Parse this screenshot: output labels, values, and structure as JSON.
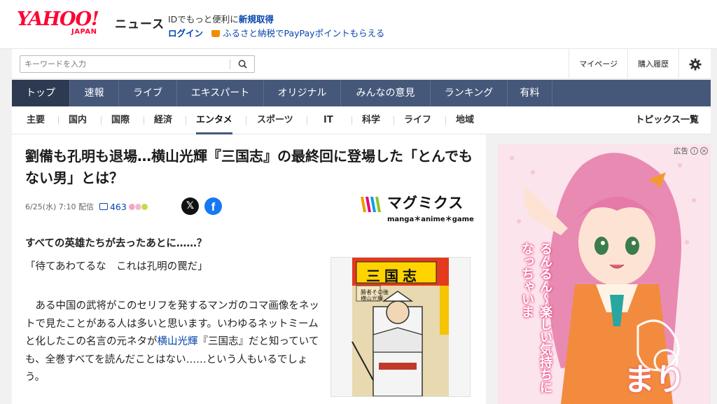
{
  "header": {
    "logo_text": "YAHOO!",
    "logo_sub": "JAPAN",
    "service": "ニュース",
    "id_prompt": "IDでもっと便利に",
    "register": "新規取得",
    "login": "ログイン",
    "promo": "ふるさと納税でPayPayポイントもらえる"
  },
  "search": {
    "placeholder": "キーワードを入力"
  },
  "header_links": [
    "マイページ",
    "購入履歴"
  ],
  "main_nav": [
    {
      "label": "トップ",
      "active": true
    },
    {
      "label": "速報"
    },
    {
      "label": "ライブ"
    },
    {
      "label": "エキスパート"
    },
    {
      "label": "オリジナル"
    },
    {
      "label": "みんなの意見"
    },
    {
      "label": "ランキング"
    },
    {
      "label": "有料"
    }
  ],
  "sub_nav": [
    "主要",
    "国内",
    "国際",
    "経済",
    "エンタメ",
    "スポーツ",
    "IT",
    "科学",
    "ライフ",
    "地域"
  ],
  "sub_nav_all": "トピックス一覧",
  "article": {
    "headline": "劉備も孔明も退場…横山光輝『三国志』の最終回に登場した「とんでもない男」とは？",
    "date": "6/25(水) 7:10",
    "delivered": "配信",
    "comments": "463",
    "publisher": "マグミクス",
    "publisher_tag": "manga＊anime＊game",
    "lead": "すべての英雄たちが去ったあとに……？",
    "quote": "「待てあわてるな　これは孔明の罠だ」",
    "p1_a": "　ある中国の武将がこのセリフを発するマンガのコマ画像をネットで見たことがある人は多いと思います。いわゆるネットミームと化したこの名言の元ネタが",
    "p1_link": "横山光輝",
    "p1_b": "『三国志』だと知っていても、全巻すべてを読んだことはない……という人もいるでしょう。",
    "thumb_title": "三国志",
    "thumb_sub": "勝者その後",
    "thumb_author": "横山光輝"
  },
  "ad": {
    "label": "広告",
    "slogan": "るんるん〜楽しい気持ちになっちゃいま",
    "logo": "まり"
  },
  "colors": {
    "nav_bg": "#46587a",
    "nav_active": "#2d3a52",
    "link": "#0645ad",
    "brand": "#ff0033"
  }
}
